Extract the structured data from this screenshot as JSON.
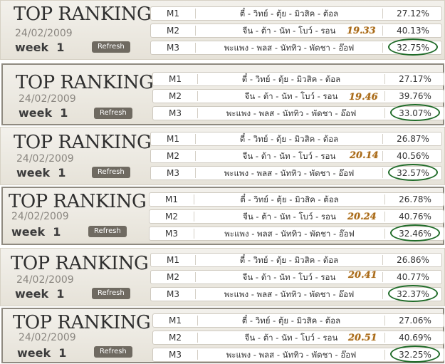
{
  "snapshots": [
    {
      "title": "TOP RANKING",
      "date": "24/02/2009",
      "week": "week  1",
      "refresh_label": "Refresh",
      "note": "19.33",
      "rows": [
        {
          "code": "M1",
          "names": "ตี๋ - วิทย์ - ตุ้ย - มิวสิค - ต้อล",
          "percent": "27.12%",
          "circled": false
        },
        {
          "code": "M2",
          "names": "จีน - ต้า - นัท - โบว์ - รอน",
          "percent": "40.13%",
          "circled": false
        },
        {
          "code": "M3",
          "names": "พะแพง - พลส - นัททิว - พัดชา - อ๊อฟ",
          "percent": "32.75%",
          "circled": true
        }
      ]
    },
    {
      "title": "TOP RANKING",
      "date": "24/02/2009",
      "week": "week  1",
      "refresh_label": "Refresh",
      "note": "19.46",
      "rows": [
        {
          "code": "M1",
          "names": "ตี๋ - วิทย์ - ตุ้ย - มิวสิค - ต้อล",
          "percent": "27.17%",
          "circled": false
        },
        {
          "code": "M2",
          "names": "จีน - ต้า - นัท - โบว์ - รอน",
          "percent": "39.76%",
          "circled": false
        },
        {
          "code": "M3",
          "names": "พะแพง - พลส - นัททิว - พัดชา - อ๊อฟ",
          "percent": "33.07%",
          "circled": true
        }
      ]
    },
    {
      "title": "TOP RANKING",
      "date": "24/02/2009",
      "week": "week  1",
      "refresh_label": "Refresh",
      "note": "20.14",
      "rows": [
        {
          "code": "M1",
          "names": "ตี๋ - วิทย์ - ตุ้ย - มิวสิค - ต้อล",
          "percent": "26.87%",
          "circled": false
        },
        {
          "code": "M2",
          "names": "จีน - ต้า - นัท - โบว์ - รอน",
          "percent": "40.56%",
          "circled": false
        },
        {
          "code": "M3",
          "names": "พะแพง - พลส - นัททิว - พัดชา - อ๊อฟ",
          "percent": "32.57%",
          "circled": true
        }
      ]
    },
    {
      "title": "TOP RANKING",
      "date": "24/02/2009",
      "week": "week  1",
      "refresh_label": "Refresh",
      "note": "20.24",
      "rows": [
        {
          "code": "M1",
          "names": "ตี๋ - วิทย์ - ตุ้ย - มิวสิค - ต้อล",
          "percent": "26.78%",
          "circled": false
        },
        {
          "code": "M2",
          "names": "จีน - ต้า - นัท - โบว์ - รอน",
          "percent": "40.76%",
          "circled": false
        },
        {
          "code": "M3",
          "names": "พะแพง - พลส - นัททิว - พัดชา - อ๊อฟ",
          "percent": "32.46%",
          "circled": true
        }
      ]
    },
    {
      "title": "TOP RANKING",
      "date": "24/02/2009",
      "week": "week  1",
      "refresh_label": "Refresh",
      "note": "20.41",
      "rows": [
        {
          "code": "M1",
          "names": "ตี๋ - วิทย์ - ตุ้ย - มิวสิค - ต้อล",
          "percent": "26.86%",
          "circled": false
        },
        {
          "code": "M2",
          "names": "จีน - ต้า - นัท - โบว์ - รอน",
          "percent": "40.77%",
          "circled": false
        },
        {
          "code": "M3",
          "names": "พะแพง - พลส - นัททิว - พัดชา - อ๊อฟ",
          "percent": "32.37%",
          "circled": true
        }
      ]
    },
    {
      "title": "TOP RANKING",
      "date": "24/02/2009",
      "week": "week  1",
      "refresh_label": "Refresh",
      "note": "20.51",
      "rows": [
        {
          "code": "M1",
          "names": "ตี๋ - วิทย์ - ตุ้ย - มิวสิค - ต้อล",
          "percent": "27.06%",
          "circled": false
        },
        {
          "code": "M2",
          "names": "จีน - ต้า - นัท - โบว์ - รอน",
          "percent": "40.69%",
          "circled": false
        },
        {
          "code": "M3",
          "names": "พะแพง - พลส - นัททิว - พัดชา - อ๊อฟ",
          "percent": "32.25%",
          "circled": true
        }
      ]
    }
  ]
}
